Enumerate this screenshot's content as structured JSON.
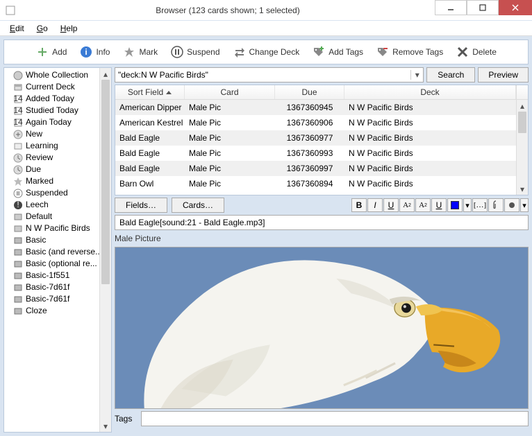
{
  "window": {
    "title": "Browser (123 cards shown; 1 selected)"
  },
  "menu": {
    "edit": "Edit",
    "go": "Go",
    "help": "Help"
  },
  "toolbar": {
    "add": "Add",
    "info": "Info",
    "mark": "Mark",
    "suspend": "Suspend",
    "changedeck": "Change Deck",
    "addtags": "Add Tags",
    "removetags": "Remove Tags",
    "delete": "Delete"
  },
  "sidebar": {
    "items": [
      "Whole Collection",
      "Current Deck",
      "Added Today",
      "Studied Today",
      "Again Today",
      "New",
      "Learning",
      "Review",
      "Due",
      "Marked",
      "Suspended",
      "Leech",
      "Default",
      "N W Pacific Birds",
      "Basic",
      "Basic (and reverse...",
      "Basic (optional re...",
      "Basic-1f551",
      "Basic-7d61f",
      "Basic-7d61f",
      "Cloze"
    ]
  },
  "search": {
    "value": "\"deck:N W Pacific Birds\"",
    "button": "Search",
    "preview": "Preview"
  },
  "table": {
    "headers": {
      "sf": "Sort Field",
      "cd": "Card",
      "du": "Due",
      "dk": "Deck"
    },
    "rows": [
      {
        "sf": "American Dipper",
        "cd": "Male Pic",
        "du": "1367360945",
        "dk": "N W Pacific Birds"
      },
      {
        "sf": "American Kestrel",
        "cd": "Male Pic",
        "du": "1367360906",
        "dk": "N W Pacific Birds"
      },
      {
        "sf": "Bald Eagle",
        "cd": "Male Pic",
        "du": "1367360977",
        "dk": "N W Pacific Birds"
      },
      {
        "sf": "Bald Eagle",
        "cd": "Male Pic",
        "du": "1367360993",
        "dk": "N W Pacific Birds"
      },
      {
        "sf": "Bald Eagle",
        "cd": "Male Pic",
        "du": "1367360997",
        "dk": "N W Pacific Birds"
      },
      {
        "sf": "Barn Owl",
        "cd": "Male Pic",
        "du": "1367360894",
        "dk": "N W Pacific Birds"
      }
    ]
  },
  "editor": {
    "fields_btn": "Fields…",
    "cards_btn": "Cards…",
    "front_value": "Bald Eagle[sound:21 - Bald Eagle.mp3]",
    "male_pic_label": "Male Picture",
    "tags_label": "Tags",
    "tags_value": ""
  }
}
